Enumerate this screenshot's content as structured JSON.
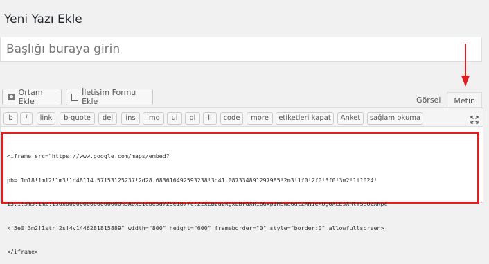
{
  "page": {
    "title": "Yeni Yazı Ekle"
  },
  "title_input": {
    "placeholder": "Başlığı buraya girin"
  },
  "media_buttons": {
    "add_media": "Ortam Ekle",
    "add_form": "İletişim Formu Ekle"
  },
  "editor_tabs": {
    "visual": "Görsel",
    "text": "Metin"
  },
  "toolbar": {
    "buttons": [
      "b",
      "i",
      "link",
      "b-quote",
      "del",
      "ins",
      "img",
      "ul",
      "ol",
      "li",
      "code",
      "more",
      "etiketleri kapat",
      "Anket",
      "sağlam okuma"
    ]
  },
  "code": {
    "lines": [
      "<iframe src=\"https://www.google.com/maps/embed?",
      "pb=!1m18!1m12!1m3!1d48114.57153125237!2d28.683616492593238!3d41.087334891297985!2m3!1f0!2f0!3f0!3m2!1i1024!",
      "13.1!3m3!1m2!1s0x0000000000000000%3A0x51cbe5d725e1877c!2zxLBza2kgxLBraXR1bGxpIMSwa6dtZXN1eXUgQXLEsXRtYSBUZXNpc",
      "k!5e0!3m2!1str!2s!4v1446281815889\" width=\"800\" height=\"600\" frameborder=\"0\" style=\"border:0\" allowfullscreen>",
      "</iframe>"
    ]
  },
  "colors": {
    "highlight_border": "#e02020",
    "arrow": "#e02020"
  }
}
